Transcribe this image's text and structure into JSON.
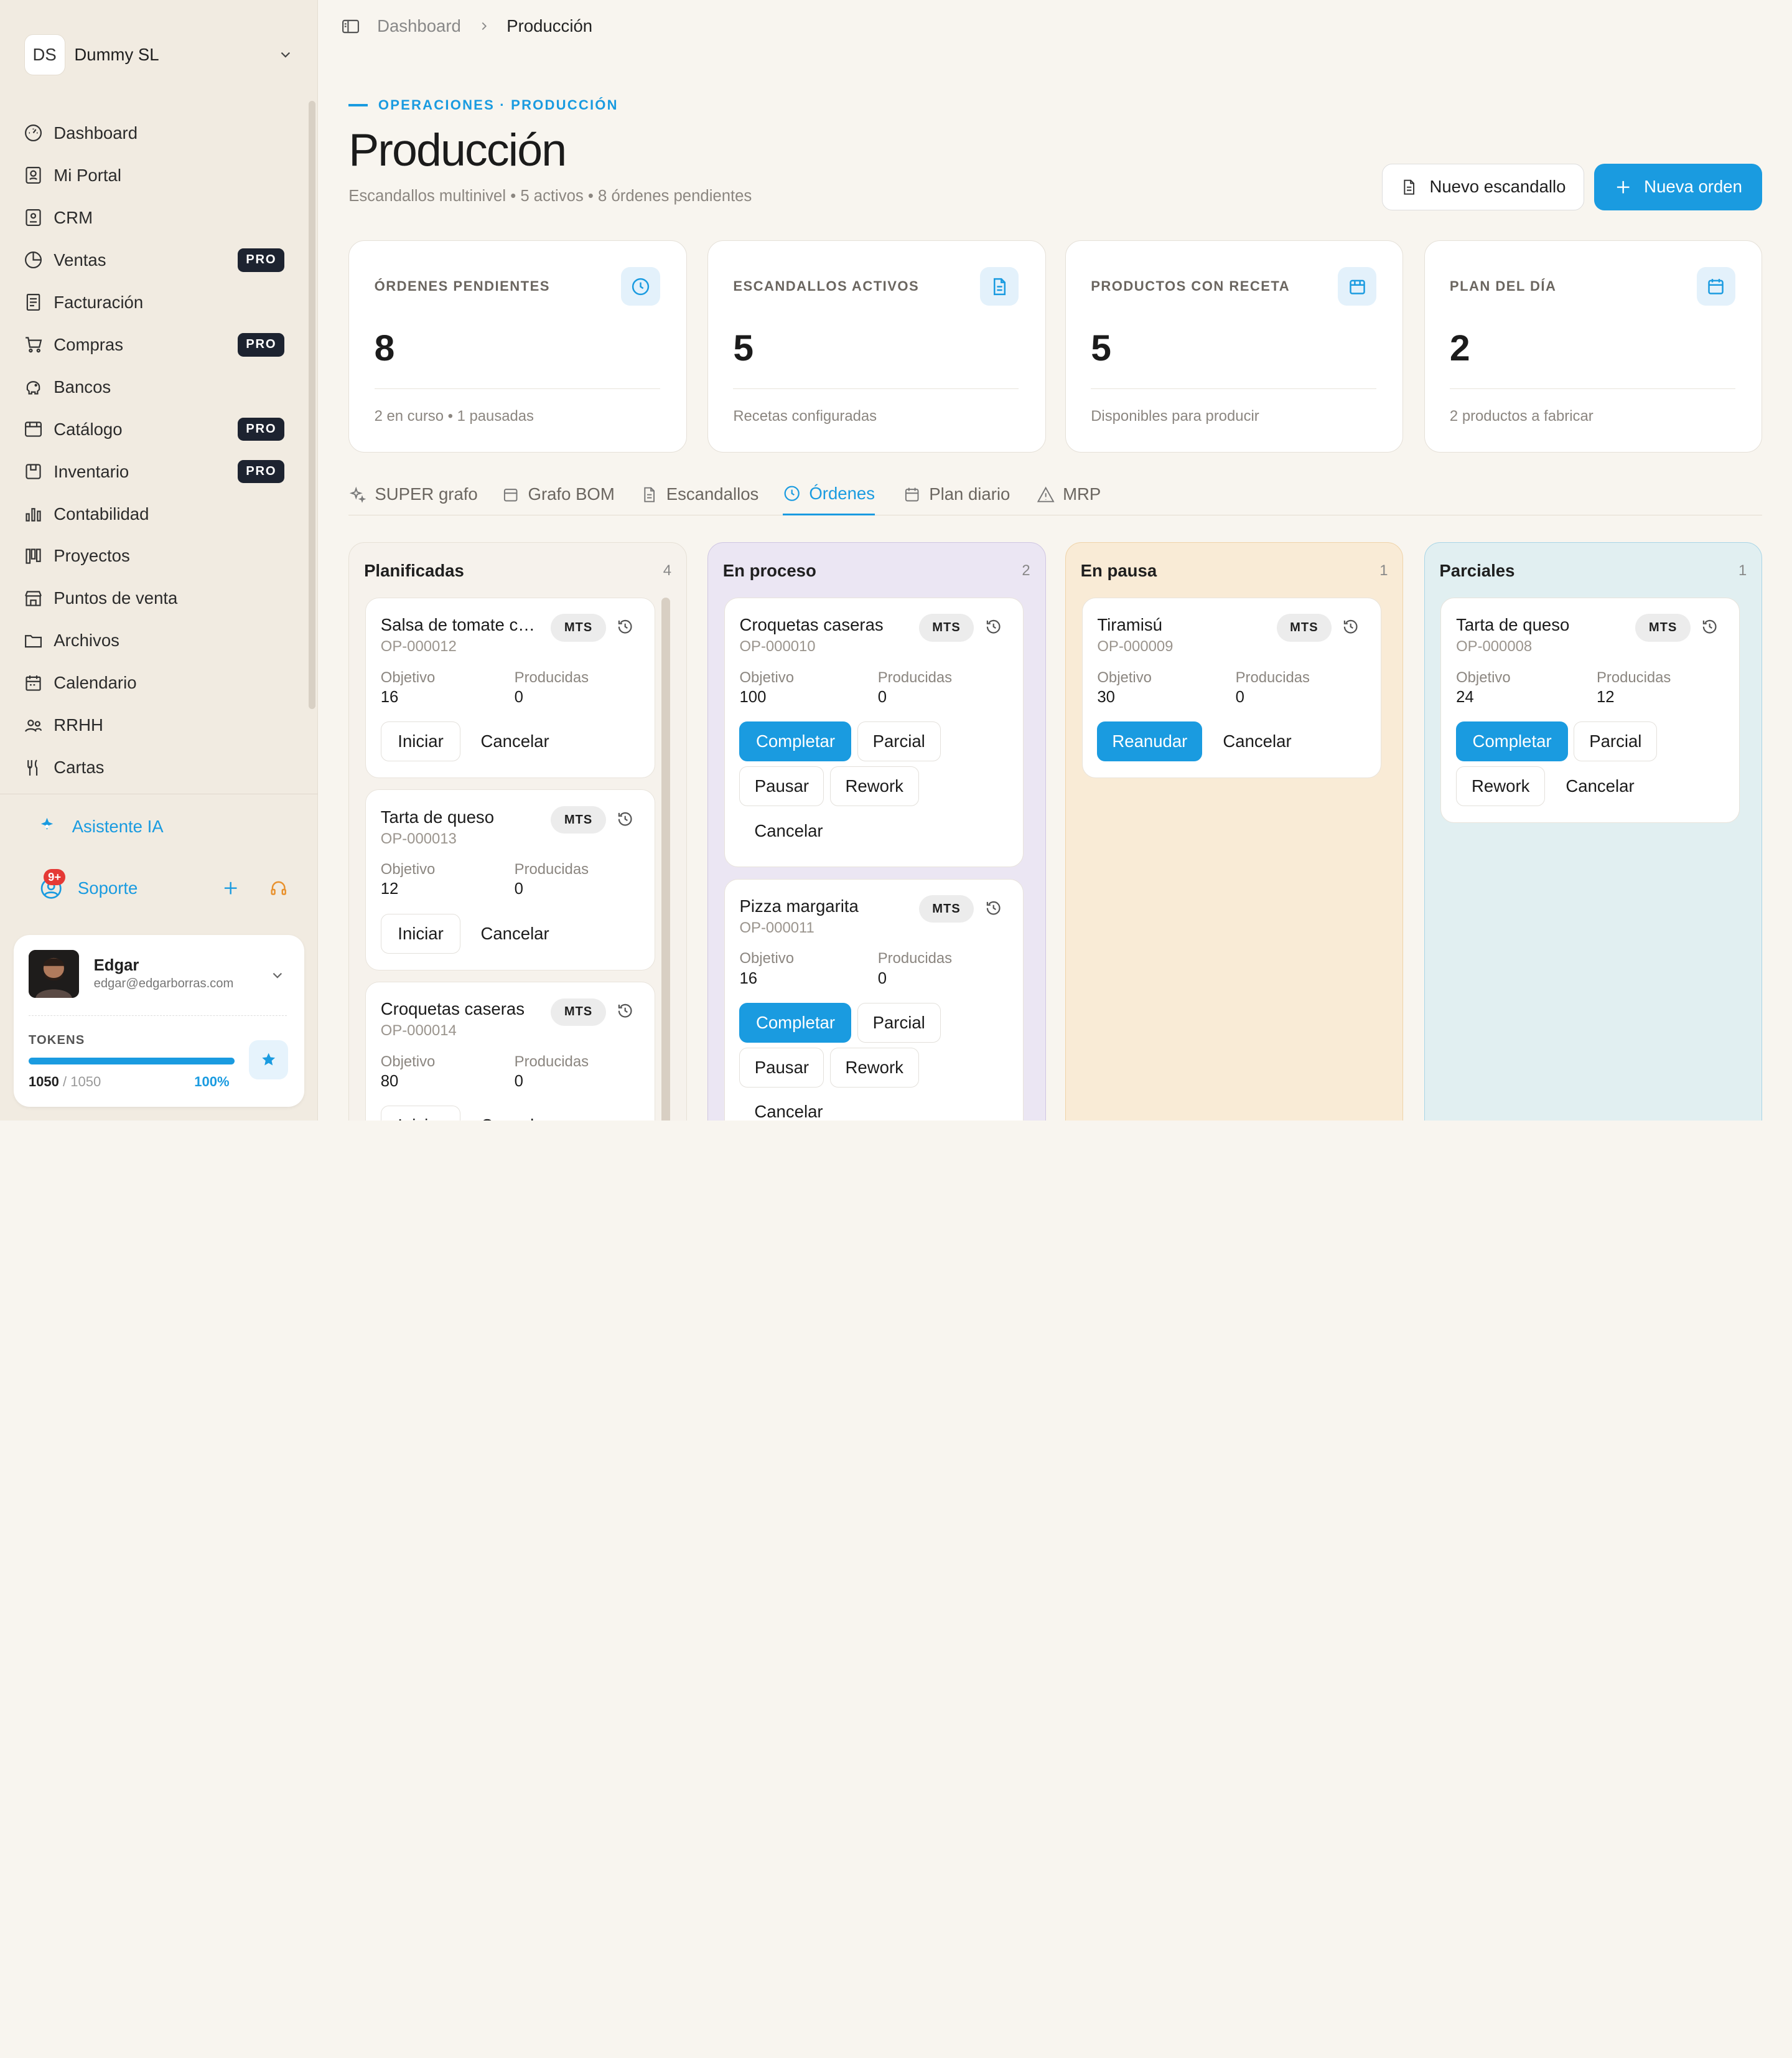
{
  "company": {
    "initials": "DS",
    "name": "Dummy SL"
  },
  "nav": [
    {
      "label": "Dashboard",
      "icon": "dashboard-icon",
      "pro": false
    },
    {
      "label": "Mi Portal",
      "icon": "portal-icon",
      "pro": false
    },
    {
      "label": "CRM",
      "icon": "crm-icon",
      "pro": false
    },
    {
      "label": "Ventas",
      "icon": "ventas-icon",
      "pro": true
    },
    {
      "label": "Facturación",
      "icon": "invoice-icon",
      "pro": false
    },
    {
      "label": "Compras",
      "icon": "cart-icon",
      "pro": true
    },
    {
      "label": "Bancos",
      "icon": "piggy-bank-icon",
      "pro": false
    },
    {
      "label": "Catálogo",
      "icon": "catalog-icon",
      "pro": true
    },
    {
      "label": "Inventario",
      "icon": "box-icon",
      "pro": true
    },
    {
      "label": "Contabilidad",
      "icon": "chart-icon",
      "pro": false
    },
    {
      "label": "Proyectos",
      "icon": "kanban-icon",
      "pro": false
    },
    {
      "label": "Puntos de venta",
      "icon": "store-icon",
      "pro": false
    },
    {
      "label": "Archivos",
      "icon": "folder-icon",
      "pro": false
    },
    {
      "label": "Calendario",
      "icon": "calendar-icon",
      "pro": false
    },
    {
      "label": "RRHH",
      "icon": "people-icon",
      "pro": false
    },
    {
      "label": "Cartas",
      "icon": "utensils-icon",
      "pro": false
    }
  ],
  "pro_label": "PRO",
  "assistant": "Asistente IA",
  "support": {
    "label": "Soporte",
    "badge": "9+"
  },
  "user": {
    "name": "Edgar",
    "email": "edgar@edgarborras.com",
    "tokens_label": "TOKENS",
    "tokens_used": "1050",
    "tokens_total": "/ 1050",
    "tokens_pct": "100%",
    "tokens_fraction": 1.0
  },
  "breadcrumb": {
    "root": "Dashboard",
    "current": "Producción"
  },
  "header": {
    "eyebrow": "OPERACIONES · PRODUCCIÓN",
    "title": "Producción",
    "subtitle": "Escandallos multinivel • 5 activos • 8 órdenes pendientes",
    "btn_secondary": "Nuevo escandallo",
    "btn_primary": "Nueva orden"
  },
  "stats": [
    {
      "label": "ÓRDENES PENDIENTES",
      "value": "8",
      "foot": "2 en curso • 1 pausadas",
      "icon": "clock-icon"
    },
    {
      "label": "ESCANDALLOS ACTIVOS",
      "value": "5",
      "foot": "Recetas configuradas",
      "icon": "document-icon"
    },
    {
      "label": "PRODUCTOS CON RECETA",
      "value": "5",
      "foot": "Disponibles para producir",
      "icon": "package-icon"
    },
    {
      "label": "PLAN DEL DÍA",
      "value": "2",
      "foot": "2 productos a fabricar",
      "icon": "calendar-icon"
    }
  ],
  "tabs": [
    {
      "label": "SUPER grafo",
      "icon": "sparkle-icon",
      "active": false
    },
    {
      "label": "Grafo BOM",
      "icon": "package-icon",
      "active": false
    },
    {
      "label": "Escandallos",
      "icon": "document-icon",
      "active": false
    },
    {
      "label": "Órdenes",
      "icon": "clock-icon",
      "active": true
    },
    {
      "label": "Plan diario",
      "icon": "calendar-icon",
      "active": false
    },
    {
      "label": "MRP",
      "icon": "warning-icon",
      "active": false
    }
  ],
  "labels": {
    "objetivo": "Objetivo",
    "producidas": "Producidas",
    "mts": "MTS"
  },
  "columns": [
    {
      "title": "Planificadas",
      "count": "4",
      "cards": [
        {
          "name": "Salsa de tomate casera",
          "code": "OP-000012",
          "objetivo": "16",
          "producidas": "0",
          "actions": [
            "Iniciar",
            "Cancelar"
          ]
        },
        {
          "name": "Tarta de queso",
          "code": "OP-000013",
          "objetivo": "12",
          "producidas": "0",
          "actions": [
            "Iniciar",
            "Cancelar"
          ]
        },
        {
          "name": "Croquetas caseras",
          "code": "OP-000014",
          "objetivo": "80",
          "producidas": "0",
          "actions": [
            "Iniciar",
            "Cancelar"
          ]
        }
      ]
    },
    {
      "title": "En proceso",
      "count": "2",
      "cards": [
        {
          "name": "Croquetas caseras",
          "code": "OP-000010",
          "objetivo": "100",
          "producidas": "0",
          "actions": [
            "Completar",
            "Parcial",
            "Pausar",
            "Rework",
            "Cancelar"
          ]
        },
        {
          "name": "Pizza margarita",
          "code": "OP-000011",
          "objetivo": "16",
          "producidas": "0",
          "actions": [
            "Completar",
            "Parcial",
            "Pausar",
            "Rework",
            "Cancelar"
          ]
        }
      ]
    },
    {
      "title": "En pausa",
      "count": "1",
      "cards": [
        {
          "name": "Tiramisú",
          "code": "OP-000009",
          "objetivo": "30",
          "producidas": "0",
          "actions": [
            "Reanudar",
            "Cancelar"
          ]
        }
      ]
    },
    {
      "title": "Parciales",
      "count": "1",
      "cards": [
        {
          "name": "Tarta de queso",
          "code": "OP-000008",
          "objetivo": "24",
          "producidas": "12",
          "actions": [
            "Completar",
            "Parcial",
            "Rework",
            "Cancelar"
          ]
        }
      ]
    }
  ],
  "colors": {
    "accent": "#1a9be0",
    "planned_bg": "#f6f2ec",
    "inprogress_bg": "#ebe6f3",
    "paused_bg": "#f9ebd6",
    "partial_bg": "#e1eff1"
  }
}
